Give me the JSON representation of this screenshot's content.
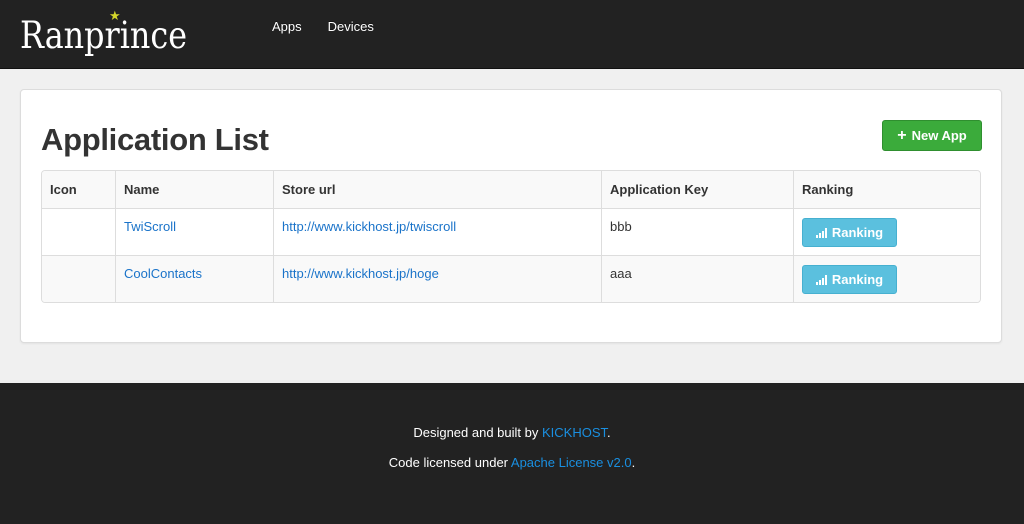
{
  "navbar": {
    "brand": "Ranprince",
    "nav_items": [
      {
        "label": "Apps"
      },
      {
        "label": "Devices"
      }
    ]
  },
  "main": {
    "title": "Application List",
    "new_app_button": "New App",
    "table": {
      "headers": [
        "Icon",
        "Name",
        "Store url",
        "Application Key",
        "Ranking"
      ],
      "rows": [
        {
          "icon": "",
          "name": "TwiScroll",
          "store_url": "http://www.kickhost.jp/twiscroll",
          "app_key": "bbb",
          "ranking_button": "Ranking"
        },
        {
          "icon": "",
          "name": "CoolContacts",
          "store_url": "http://www.kickhost.jp/hoge",
          "app_key": "aaa",
          "ranking_button": "Ranking"
        }
      ]
    }
  },
  "footer": {
    "line1_prefix": "Designed and built by ",
    "line1_link": "KICKHOST",
    "line1_suffix": ".",
    "line2_prefix": "Code licensed under ",
    "line2_link": "Apache License v2.0",
    "line2_suffix": "."
  },
  "colors": {
    "navbar_bg": "#222222",
    "primary_link": "#1a73c9",
    "success": "#3bab3b",
    "info": "#5bc0de",
    "star": "#d4d62a"
  },
  "icons": {
    "brand_star": "star-icon",
    "new_app": "plus-icon",
    "ranking": "signal-bars-icon"
  }
}
